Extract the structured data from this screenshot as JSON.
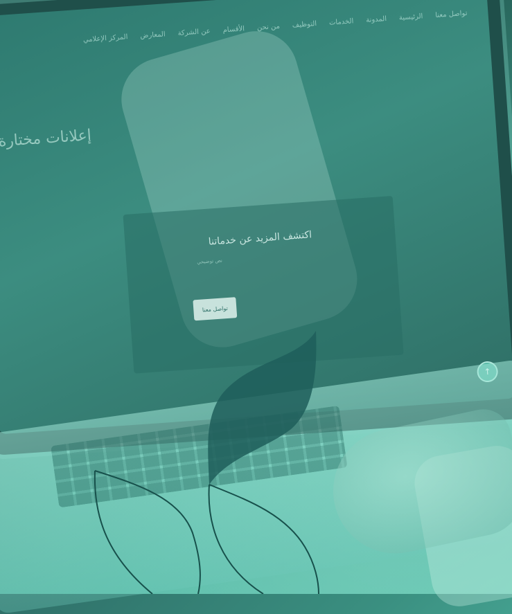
{
  "screen": {
    "nav_items": [
      "تواصل معنا",
      "الرئيسية",
      "المدونة",
      "الخدمات",
      "التوظيف",
      "من نحن",
      "الأقسام",
      "عن الشركة",
      "المعارض",
      "المركز الإعلامي"
    ],
    "hero_title": "إعلانات مختارة",
    "panel_title": "اكتشف المزيد عن خدماتنا",
    "panel_text": "نص توضيحي",
    "panel_button": "تواصل معنا"
  },
  "colors": {
    "overlay": "#4fb3a0",
    "dark_teal": "#1f4f4a",
    "logo_fill": "#1e5e5a",
    "logo_stroke": "#17504b"
  },
  "icons": [
    "arrow-up-icon",
    "brand-leaf-logo-icon"
  ]
}
